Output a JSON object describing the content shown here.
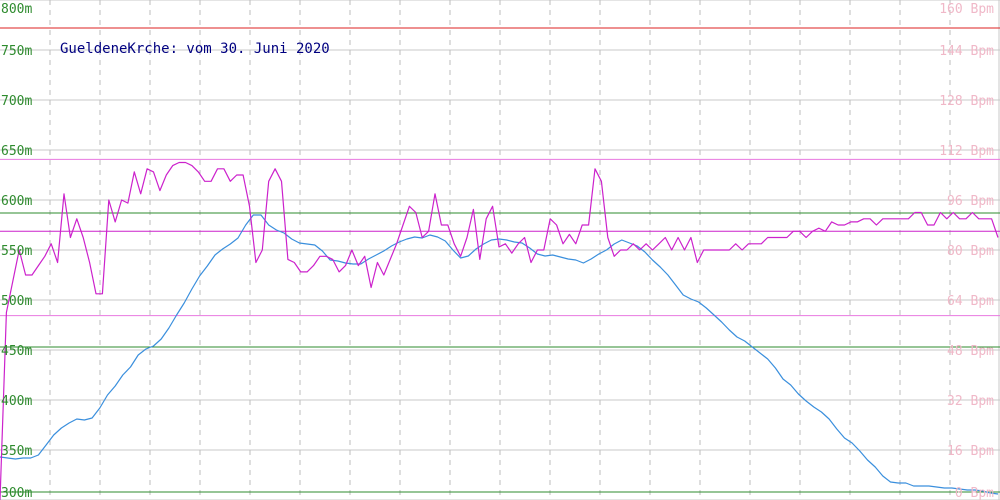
{
  "chart_data": {
    "type": "line",
    "title": "GueldeneKrche: vom 30. Juni 2020",
    "xlabel": "",
    "ylabel": "",
    "grid": true,
    "x_count": 200,
    "y_left": {
      "range": [
        300,
        800
      ],
      "unit": "m",
      "ticks": [
        "300m",
        "350m",
        "400m",
        "450m",
        "500m",
        "550m",
        "600m",
        "650m",
        "700m",
        "750m",
        "800m"
      ],
      "tick_values": [
        300,
        350,
        400,
        450,
        500,
        550,
        600,
        650,
        700,
        750,
        800
      ],
      "color": "#2e8b2e"
    },
    "y_right": {
      "range": [
        0,
        160
      ],
      "unit": "Bpm",
      "ticks": [
        "0 Bpm",
        "16 Bpm",
        "32 Bpm",
        "48 Bpm",
        "64 Bpm",
        "80 Bpm",
        "96 Bpm",
        "112 Bpm",
        "128 Bpm",
        "144 Bpm",
        "160 Bpm"
      ],
      "tick_values": [
        0,
        16,
        32,
        48,
        64,
        80,
        96,
        112,
        128,
        144,
        160
      ],
      "color": "#f0b8c8"
    },
    "reference_lines": [
      {
        "axis": "left",
        "value": 772,
        "color": "#dd2222"
      },
      {
        "axis": "left",
        "value": 587,
        "color": "#2e8b2e"
      },
      {
        "axis": "left",
        "value": 453,
        "color": "#2e8b2e"
      },
      {
        "axis": "left",
        "value": 308,
        "color": "#2e8b2e"
      },
      {
        "axis": "right",
        "value": 109,
        "color": "#e878e0"
      },
      {
        "axis": "right",
        "value": 86,
        "color": "#cc22cc"
      },
      {
        "axis": "right",
        "value": 59,
        "color": "#e878e0"
      }
    ],
    "series": [
      {
        "axis": "left",
        "color": "#3a8fdd",
        "values": [
          343,
          342,
          341,
          342,
          342,
          345,
          355,
          365,
          372,
          377,
          381,
          380,
          382,
          392,
          405,
          414,
          425,
          433,
          445,
          451,
          454,
          461,
          472,
          485,
          497,
          511,
          524,
          534,
          545,
          551,
          556,
          562,
          575,
          585,
          585,
          575,
          570,
          567,
          561,
          557,
          556,
          555,
          549,
          540,
          539,
          537,
          536,
          536,
          541,
          545,
          549,
          554,
          558,
          561,
          563,
          562,
          565,
          563,
          559,
          550,
          542,
          544,
          551,
          556,
          560,
          561,
          560,
          558,
          557,
          552,
          546,
          544,
          545,
          543,
          541,
          540,
          537,
          541,
          546,
          550,
          556,
          560,
          557,
          554,
          548,
          540,
          533,
          525,
          515,
          505,
          501,
          498,
          492,
          485,
          478,
          470,
          463,
          459,
          453,
          447,
          441,
          432,
          421,
          415,
          406,
          399,
          393,
          388,
          381,
          371,
          362,
          357,
          349,
          340,
          333,
          324,
          318,
          317,
          317,
          314,
          314,
          314,
          313,
          312,
          312,
          311,
          310,
          310,
          309,
          307,
          306
        ]
      },
      {
        "axis": "right",
        "color": "#cc22cc",
        "values": [
          0,
          60,
          70,
          80,
          72,
          72,
          75,
          78,
          82,
          76,
          98,
          84,
          90,
          84,
          76,
          66,
          66,
          96,
          89,
          96,
          95,
          105,
          98,
          106,
          105,
          99,
          104,
          107,
          108,
          108,
          107,
          105,
          102,
          102,
          106,
          106,
          102,
          104,
          104,
          94,
          76,
          80,
          102,
          106,
          102,
          77,
          76,
          73,
          73,
          75,
          78,
          78,
          77,
          73,
          75,
          80,
          75,
          78,
          68,
          76,
          72,
          77,
          82,
          88,
          94,
          92,
          84,
          86,
          98,
          88,
          88,
          82,
          78,
          84,
          93,
          77,
          90,
          94,
          81,
          82,
          79,
          82,
          84,
          76,
          80,
          80,
          90,
          88,
          82,
          85,
          82,
          88,
          88,
          106,
          102,
          84,
          78,
          80,
          80,
          82,
          80,
          82,
          80,
          82,
          84,
          80,
          84,
          80,
          84,
          76,
          80,
          80,
          80,
          80,
          80,
          82,
          80,
          82,
          82,
          82,
          84,
          84,
          84,
          84,
          86,
          86,
          84,
          86,
          87,
          86,
          89,
          88,
          88,
          89,
          89,
          90,
          90,
          88,
          90,
          90,
          90,
          90,
          90,
          92,
          92,
          88,
          88,
          92,
          90,
          92,
          90,
          90,
          92,
          90,
          90,
          90,
          84
        ],
        "pattern": "approximate"
      }
    ]
  }
}
